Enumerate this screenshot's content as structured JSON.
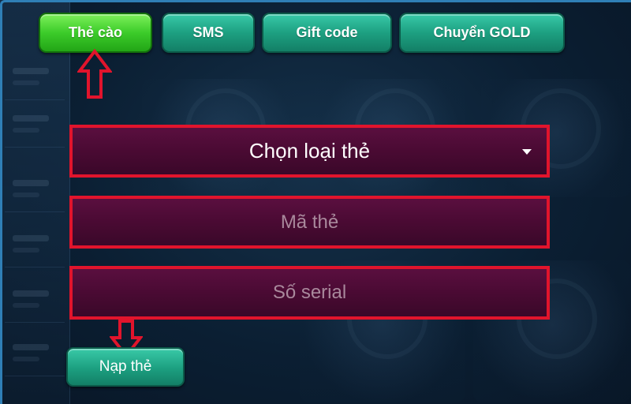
{
  "tabs": [
    {
      "label": "Thẻ cào",
      "active": true
    },
    {
      "label": "SMS",
      "active": false
    },
    {
      "label": "Gift code",
      "active": false
    },
    {
      "label": "Chuyển GOLD",
      "active": false
    }
  ],
  "form": {
    "card_type_select": {
      "label": "Chọn loại thẻ",
      "icon": "chevron-down-icon"
    },
    "card_code": {
      "value": "",
      "placeholder": "Mã thẻ"
    },
    "serial": {
      "value": "",
      "placeholder": "Số serial"
    },
    "submit_label": "Nạp thẻ"
  },
  "annotations": {
    "highlight_color": "#e1142c",
    "arrow_icon": "arrow-icon"
  },
  "colors": {
    "tab_active": "#3ccc2a",
    "tab_inactive": "#1da081",
    "field_bg": "#4a0a33",
    "page_bg": "#0b1f33"
  }
}
